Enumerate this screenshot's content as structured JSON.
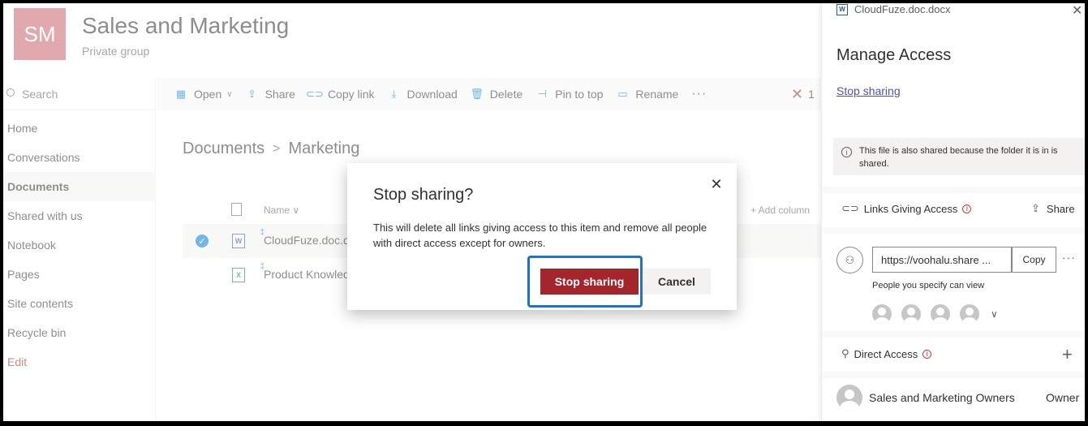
{
  "header": {
    "logo_initials": "SM",
    "site_title": "Sales and Marketing",
    "site_subtitle": "Private group"
  },
  "leftnav": {
    "search_placeholder": "Search",
    "items": [
      {
        "label": "Home"
      },
      {
        "label": "Conversations"
      },
      {
        "label": "Documents"
      },
      {
        "label": "Shared with us"
      },
      {
        "label": "Notebook"
      },
      {
        "label": "Pages"
      },
      {
        "label": "Site contents"
      },
      {
        "label": "Recycle bin"
      },
      {
        "label": "Edit"
      }
    ],
    "selected": "Documents"
  },
  "commandbar": {
    "open": "Open",
    "share": "Share",
    "copy_link": "Copy link",
    "download": "Download",
    "delete": "Delete",
    "pin_to_top": "Pin to top",
    "rename": "Rename",
    "more": "···",
    "selected_count": "1"
  },
  "breadcrumb": {
    "root": "Documents",
    "current": "Marketing"
  },
  "list": {
    "col_name": "Name",
    "add_column": "+ Add column",
    "rows": [
      {
        "name": "CloudFuze.doc.docx",
        "type": "word",
        "selected": true
      },
      {
        "name": "Product Knowledge",
        "type": "excel",
        "selected": false
      }
    ]
  },
  "dialog": {
    "title": "Stop sharing?",
    "message": "This will delete all links giving access to this item and remove all people with direct access except for owners.",
    "confirm_label": "Stop sharing",
    "cancel_label": "Cancel"
  },
  "panel": {
    "file_name": "CloudFuze.doc.docx",
    "title": "Manage Access",
    "stop_sharing_link": "Stop sharing",
    "info_text": "This file is also shared because the folder it is in is shared.",
    "links_heading": "Links Giving Access",
    "share_label": "Share",
    "link_url": "https://voohalu.share ...",
    "copy_label": "Copy",
    "link_permission": "People you specify can view",
    "direct_heading": "Direct Access",
    "owner_name": "Sales and Marketing Owners",
    "owner_role": "Owner"
  },
  "colors": {
    "accent_red": "#a4262c",
    "highlight_blue": "#1e74c4",
    "logo_bg": "#c8636b",
    "link_purple": "#4f52b2"
  }
}
